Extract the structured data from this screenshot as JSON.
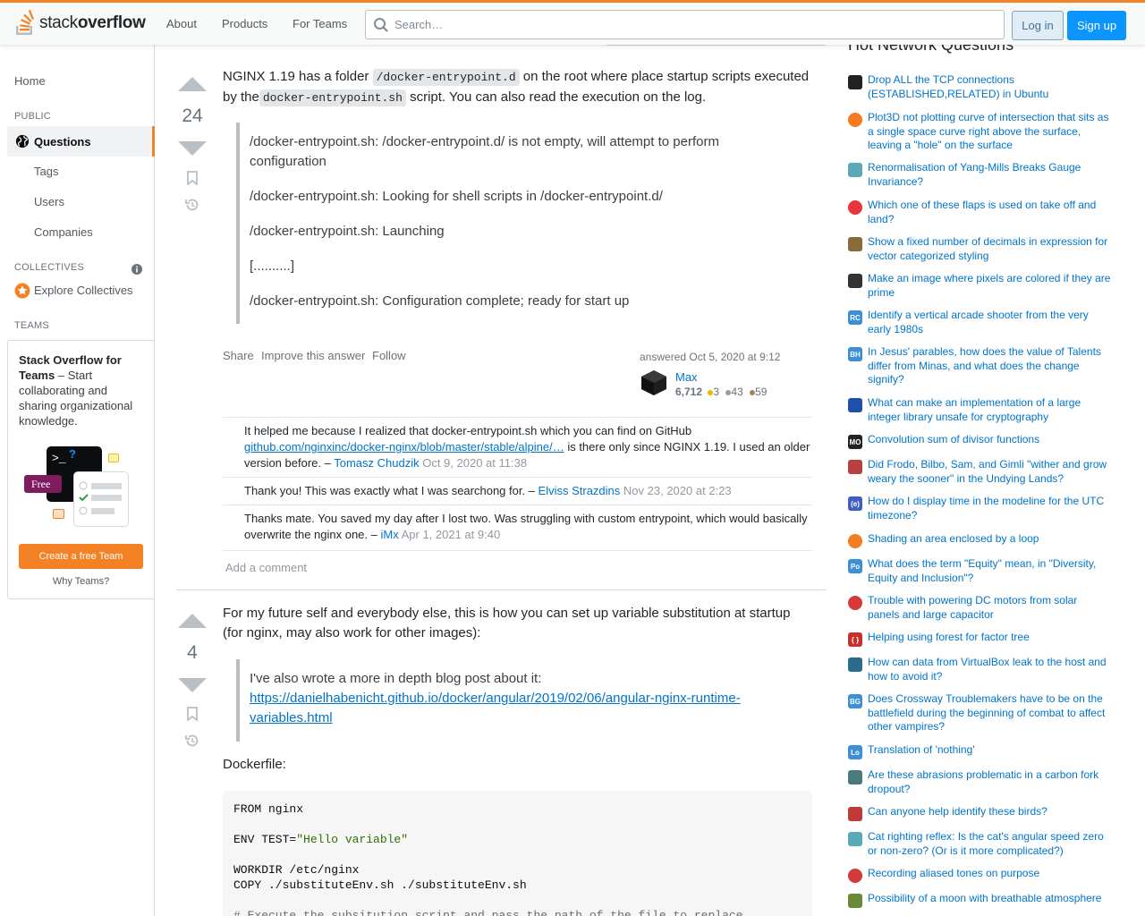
{
  "header": {
    "logo_text_light": "stack",
    "logo_text_bold": "overflow",
    "nav": [
      "About",
      "Products",
      "For Teams"
    ],
    "search_placeholder": "Search…",
    "login": "Log in",
    "signup": "Sign up",
    "accent_color": "#f48225"
  },
  "leftbar": {
    "home": "Home",
    "public_heading": "PUBLIC",
    "questions": "Questions",
    "tags": "Tags",
    "users": "Users",
    "companies": "Companies",
    "collectives_heading": "COLLECTIVES",
    "explore_collectives": "Explore Collectives",
    "teams_heading": "TEAMS",
    "teams_title": "Stack Overflow for Teams",
    "teams_desc": " – Start collaborating and sharing organizational knowledge.",
    "free_badge": "Free",
    "create_team": "Create a free Team",
    "why_teams": "Why Teams?"
  },
  "answer1": {
    "votes": "24",
    "p1_a": "NGINX 1.19 has a folder ",
    "p1_code1": "/docker-entrypoint.d",
    "p1_b": " on the root where place startup scripts executed",
    "p1_c": "by the",
    "p1_code2": "docker-entrypoint.sh",
    "p1_d": " script. You can also read the execution on the log.",
    "quote_lines": [
      "/docker-entrypoint.sh: /docker-entrypoint.d/ is not empty, will attempt to perform",
      "configuration",
      "/docker-entrypoint.sh: Looking for shell scripts in /docker-entrypoint.d/",
      "/docker-entrypoint.sh: Launching",
      "[..........]",
      "/docker-entrypoint.sh: Configuration complete; ready for start up"
    ],
    "menu": [
      "Share",
      "Improve this answer",
      "Follow"
    ],
    "answered": "answered Oct 5, 2020 at 9:12",
    "user_name": "Max",
    "reputation": "6,712",
    "gold": "3",
    "silver": "43",
    "bronze": "59",
    "comments": [
      {
        "text_a": "It helped me because I realized that docker-entrypoint.sh which you can find on GitHub ",
        "link": "github.com/nginxinc/docker-nginx/blob/master/stable/alpine/…",
        "text_b": " is there only since NGINX 1.19. I used an older version before. – ",
        "user": "Tomasz Chudzik",
        "date": "Oct 9, 2020 at 11:38"
      },
      {
        "text_a": "Thank you! This was exactly what I was searchong for. – ",
        "user": "Elviss Strazdins",
        "date": "Nov 23, 2020 at 2:23"
      },
      {
        "text_a": "Thanks mate. You saved my day after I lost two. Was struggling with custom entrypoint, which would basically overwrite the nginx one. – ",
        "user": "iMx",
        "date": "Apr 1, 2021 at 9:40"
      }
    ],
    "add_comment": "Add a comment"
  },
  "answer2": {
    "votes": "4",
    "p1_line1": "For my future self and everybody else, this is how you can set up variable substitution at startup",
    "p1_line2": "(for nginx, may also work for other images):",
    "quote_line1": "I've also wrote a more in depth blog post about it:",
    "quote_link1": "https://danielhabenicht.github.io/docker/angular/2019/02/06/angular-nginx-runtime-",
    "quote_link2": "variables.html",
    "dockerfile_label": "Dockerfile:",
    "code_l1": "FROM nginx",
    "code_l2a": "ENV TEST=",
    "code_l2b": "\"Hello variable\"",
    "code_l3": "WORKDIR /etc/nginx",
    "code_l4": "COPY ./substituteEnv.sh ./substituteEnv.sh",
    "code_l5": "# Execute the subsitution script and pass the path of the file to replace"
  },
  "hnq": {
    "title": "Hot Network Questions",
    "items": [
      "Drop ALL the TCP connections (ESTABLISHED,RELATED) in Ubuntu",
      "Plot3D not plotting curve of intersection that sits as a single space curve right above the surface, leaving a \"hole\" on the surface",
      "Renormalisation of Yang-Mills Breaks Gauge Invariance?",
      "Which one of these flaps is used on take off and land?",
      "Show a fixed number of decimals in expression for vector categorized styling",
      "Make an image where pixels are colored if they are prime",
      "Identify a vertical arcade shooter from the very early 1980s",
      "In Jesus' parables, how does the value of Talents differ from Minas, and what does the change signify?",
      "What can make an implementation of a large integer library unsafe for cryptography",
      "Convolution sum of divisor functions",
      "Did Frodo, Bilbo, Sam, and Gimli \"wither and grow weary the sooner\" in the Undying Lands?",
      "How do I display time in the modeline for the UTC timezone?",
      "Shading an area enclosed by a loop",
      "What does the term \"Equity\" mean, in \"Diversity, Equity and Inclusion\"?",
      "Trouble with powering DC motors from solar panels and large capacitor",
      "Helping using forest for factor tree",
      "How can data from VirtualBox leak to the host and how to avoid it?",
      "Does Crossway Troublemakers have to be on the battlefield during the beginning of combat to affect other vampires?",
      "Translation of 'nothing'",
      "Are these abrasions problematic in a carbon fork dropout?",
      "Can anyone help identify these birds?",
      "Cat righting reflex: Is the cat's angular speed zero or non-zero? (Or is it more complicated?)",
      "Recording aliased tones on purpose",
      "Possibility of a moon with breathable atmosphere"
    ],
    "icon_labels": [
      "",
      "",
      "",
      "",
      "",
      "",
      "RC",
      "BH",
      "",
      "MO",
      "",
      "(e)",
      "",
      "Po",
      "",
      "{ }",
      "",
      "BG",
      "Lo",
      "",
      "",
      "",
      "",
      ""
    ]
  }
}
